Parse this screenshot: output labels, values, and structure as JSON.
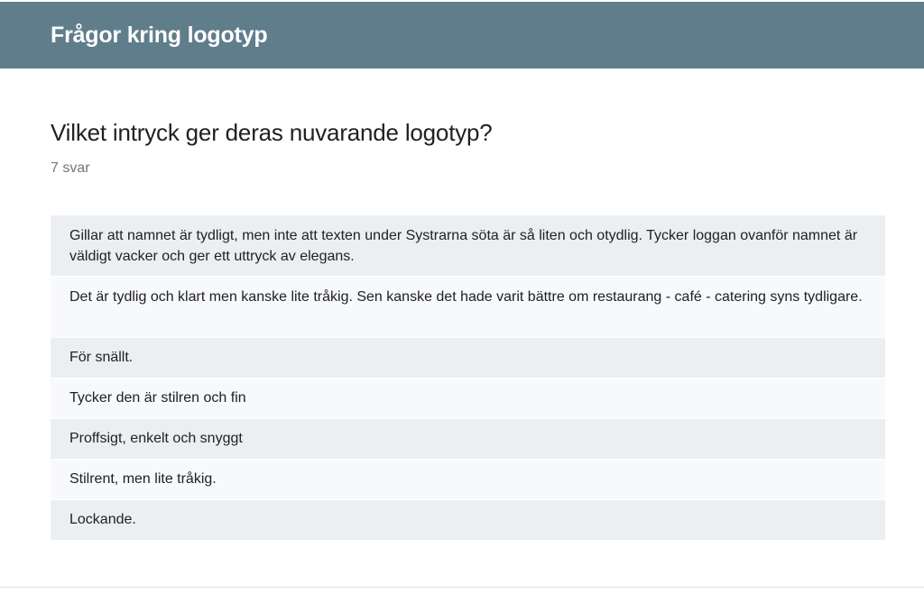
{
  "header": {
    "title": "Frågor kring logotyp"
  },
  "question": {
    "title": "Vilket intryck ger deras nuvarande logotyp?",
    "response_count": "7 svar"
  },
  "responses": [
    "Gillar att namnet är tydligt, men inte att texten under Systrarna söta är så liten och otydlig. Tycker loggan ovanför namnet är väldigt vacker och ger ett uttryck av elegans.",
    "Det är tydlig och klart men kanske lite tråkig. Sen kanske det hade varit bättre om restaurang - café - catering syns tydligare.",
    "För snällt.",
    "Tycker den är stilren och fin",
    "Proffsigt, enkelt och snyggt",
    "Stilrent, men lite tråkig.",
    "Lockande."
  ],
  "colors": {
    "header_bg": "#607d8b",
    "row_odd": "#eceff1",
    "row_even": "#f8f9fa"
  }
}
